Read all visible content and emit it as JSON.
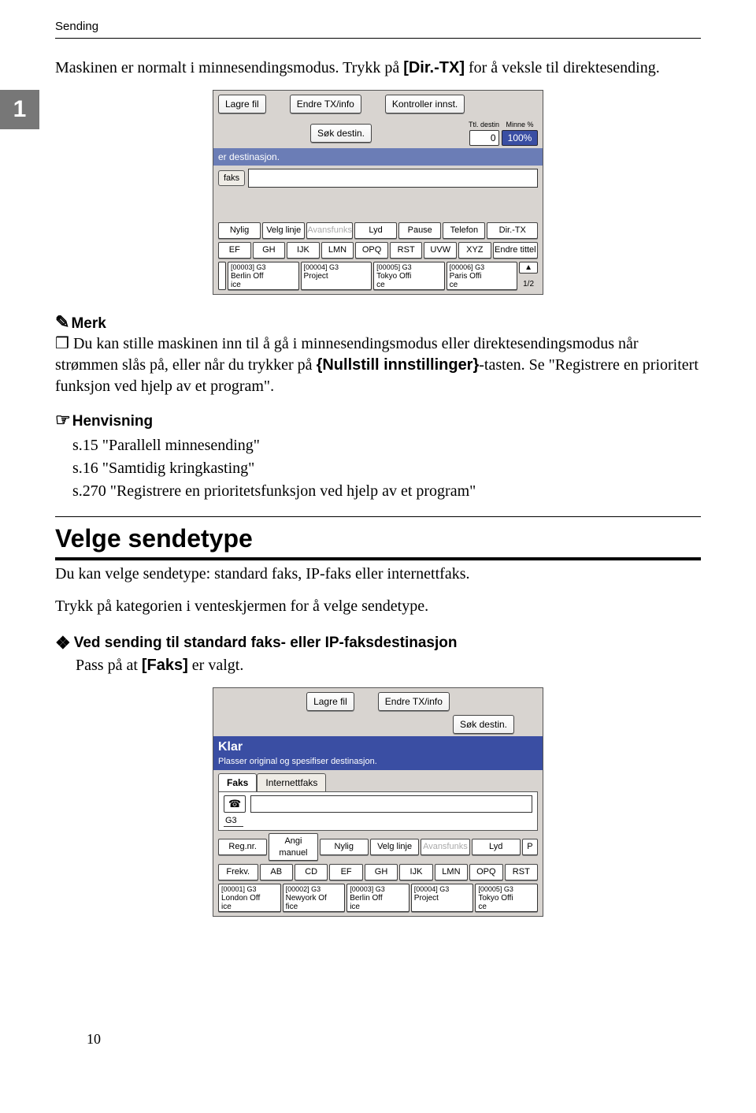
{
  "running_head": "Sending",
  "page_number": "10",
  "step_tab": "1",
  "intro_para_before": "Maskinen er normalt i minnesendingsmodus. Trykk på ",
  "intro_para_bold": "[Dir.-TX]",
  "intro_para_after": " for å veksle til direktesending.",
  "note": {
    "title": "Merk",
    "box": "❒",
    "body_a": "Du kan stille maskinen inn til å gå i minnesendingsmodus eller direktesendingsmodus når strømmen slås på, eller når du trykker på ",
    "body_bold": "{Nullstill innstillinger}",
    "body_b": "-tasten. Se \"Registrere en prioritert funksjon ved hjelp av et program\"."
  },
  "ref": {
    "title": "Henvisning",
    "items": [
      "s.15 \"Parallell minnesending\"",
      "s.16 \"Samtidig kringkasting\"",
      "s.270 \"Registrere en prioritetsfunksjon ved hjelp av et program\""
    ]
  },
  "h2": "Velge sendetype",
  "h2_p1": "Du kan velge sendetype: standard faks, IP-faks eller internettfaks.",
  "h2_p2": "Trykk på kategorien i venteskjermen for å velge sendetype.",
  "diamond_head": "Ved sending til standard faks- eller IP-faksdestinasjon",
  "diamond_body_a": "Pass på at ",
  "diamond_body_bold": "[Faks]",
  "diamond_body_b": " er valgt.",
  "panel1": {
    "top_btns": [
      "Lagre fil",
      "Endre TX/info",
      "Kontroller innst."
    ],
    "search": "Søk destin.",
    "ttl_label": "Ttl. destin",
    "ttl_value": "0",
    "mem_label": "Minne %",
    "mem_value": "100%",
    "addr_prompt": "er destinasjon.",
    "left_tab": "faks",
    "row1": [
      "Nylig",
      "Velg linje",
      "Avansfunks",
      "Lyd",
      "Pause",
      "Telefon",
      "Dir.-TX"
    ],
    "row2": [
      "EF",
      "GH",
      "IJK",
      "LMN",
      "OPQ",
      "RST",
      "UVW",
      "XYZ",
      "Endre tittel"
    ],
    "dest_row": [
      {
        "code": "[00003] G3",
        "l1": "Berlin Off",
        "l2": "ice"
      },
      {
        "code": "[00004] G3",
        "l1": "Project",
        "l2": ""
      },
      {
        "code": "[00005] G3",
        "l1": "Tokyo Offi",
        "l2": "ce"
      },
      {
        "code": "[00006] G3",
        "l1": "Paris Offi",
        "l2": "ce"
      }
    ],
    "page_ind": "1/2"
  },
  "panel2": {
    "top_btns": [
      "Lagre fil",
      "Endre TX/info"
    ],
    "status": "Klar",
    "status_sub": "Plasser original og spesifiser destinasjon.",
    "search": "Søk destin.",
    "tabs": [
      "Faks",
      "Internettfaks"
    ],
    "line_icon": "☎",
    "line_label": "G3",
    "row1": [
      "Reg.nr.",
      "Angi manuel",
      "Nylig",
      "Velg linje",
      "Avansfunks",
      "Lyd",
      "P"
    ],
    "row2": [
      "Frekv.",
      "AB",
      "CD",
      "EF",
      "GH",
      "IJK",
      "LMN",
      "OPQ",
      "RST"
    ],
    "dest_row": [
      {
        "code": "[00001] G3",
        "l1": "London Off",
        "l2": "ice"
      },
      {
        "code": "[00002] G3",
        "l1": "Newyork Of",
        "l2": "fice"
      },
      {
        "code": "[00003] G3",
        "l1": "Berlin Off",
        "l2": "ice"
      },
      {
        "code": "[00004] G3",
        "l1": "Project",
        "l2": ""
      },
      {
        "code": "[00005] G3",
        "l1": "Tokyo Offi",
        "l2": "ce"
      }
    ]
  }
}
